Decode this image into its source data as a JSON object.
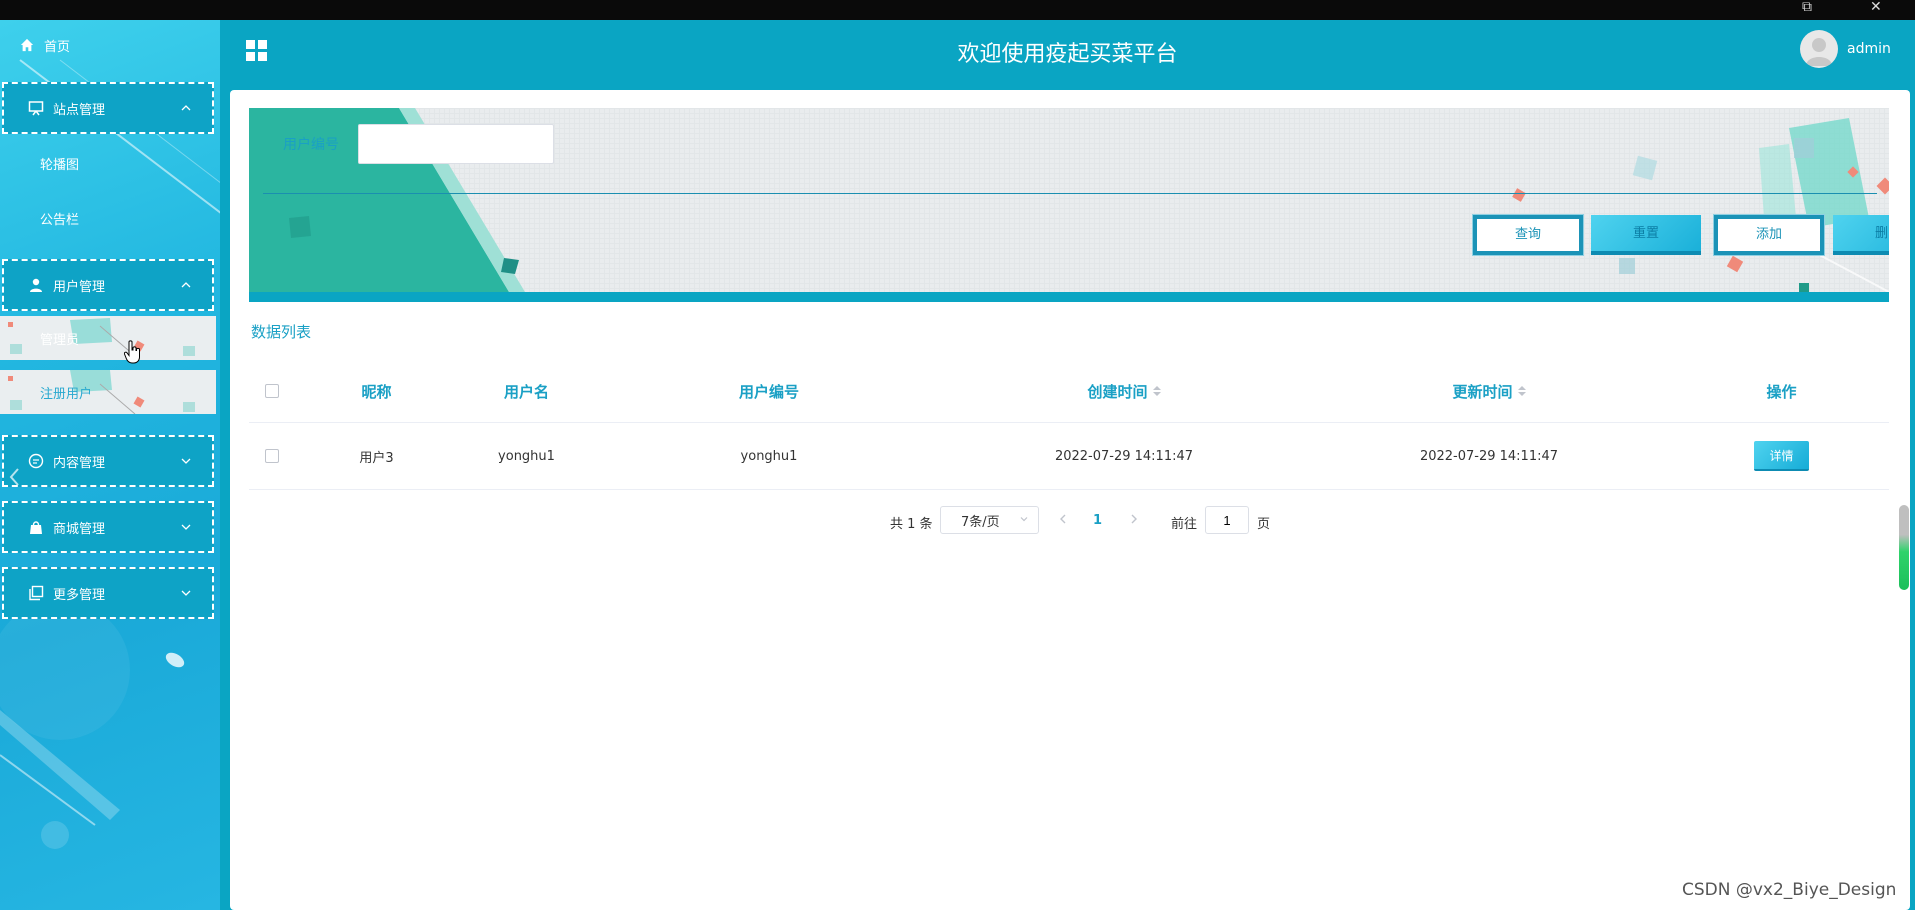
{
  "header": {
    "title": "欢迎使用疫起买菜平台",
    "username": "admin"
  },
  "sidebar": {
    "home": "首页",
    "groups": [
      {
        "label": "站点管理",
        "icon": "monitor-icon",
        "expanded": true,
        "items": [
          "轮播图",
          "公告栏"
        ]
      },
      {
        "label": "用户管理",
        "icon": "user-icon",
        "expanded": true,
        "items": [
          "管理员",
          "注册用户"
        ]
      },
      {
        "label": "内容管理",
        "icon": "chat-icon",
        "expanded": false,
        "items": []
      },
      {
        "label": "商城管理",
        "icon": "bag-icon",
        "expanded": false,
        "items": []
      },
      {
        "label": "更多管理",
        "icon": "copy-icon",
        "expanded": false,
        "items": []
      }
    ]
  },
  "search": {
    "label": "用户编号",
    "value": "",
    "placeholder": ""
  },
  "buttons": {
    "query": "查询",
    "reset": "重置",
    "add": "添加",
    "delete": "删除"
  },
  "list": {
    "title": "数据列表",
    "columns": [
      "昵称",
      "用户名",
      "用户编号",
      "创建时间",
      "更新时间",
      "操作"
    ],
    "rows": [
      {
        "nickname": "用户3",
        "username": "yonghu1",
        "user_no": "yonghu1",
        "created": "2022-07-29 14:11:47",
        "updated": "2022-07-29 14:11:47",
        "action": "详情"
      }
    ]
  },
  "pager": {
    "total": "共 1 条",
    "page_size": "7条/页",
    "current": "1",
    "goto_label": "前往",
    "goto_value": "1",
    "page_suffix": "页"
  },
  "watermark": "CSDN @vx2_Biye_Design",
  "colors": {
    "primary": "#0aa5c3",
    "accent_text": "#1aa0c5",
    "sidebar": "#22b7e0"
  }
}
